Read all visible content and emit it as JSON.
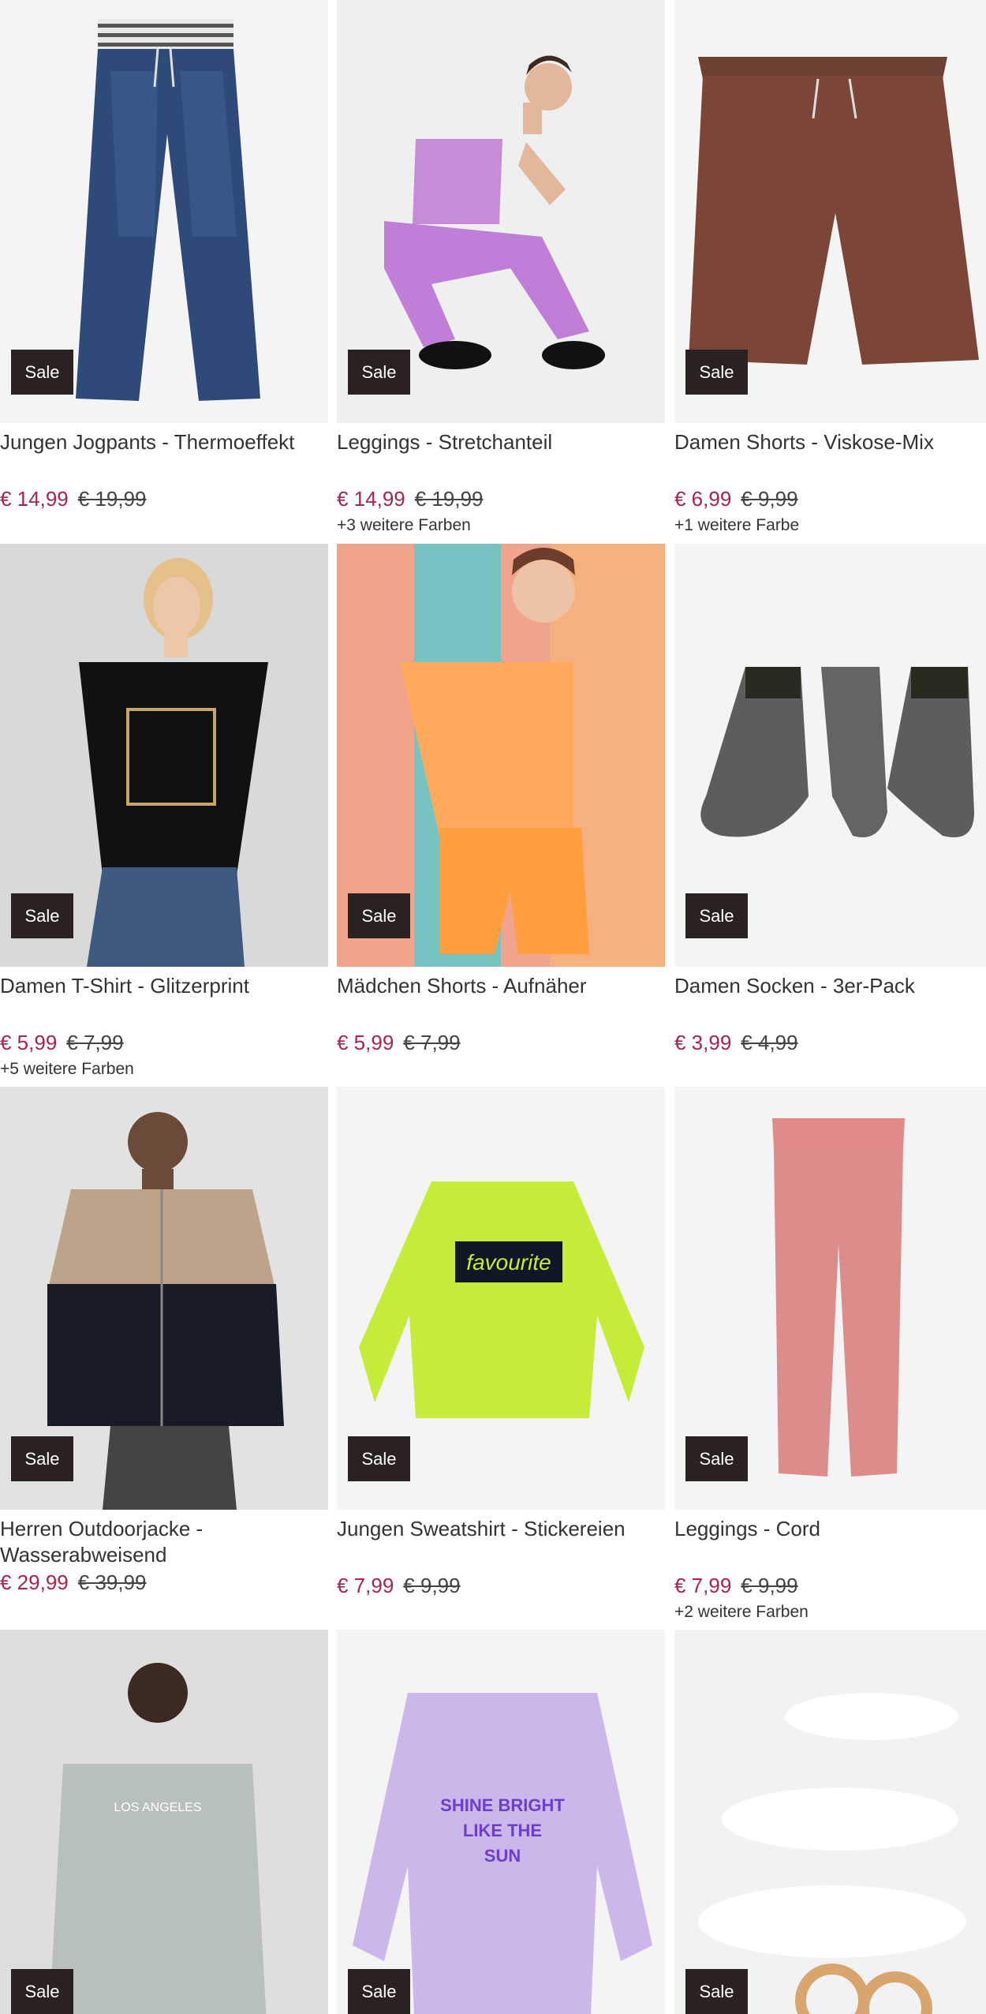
{
  "products": [
    {
      "title": "Jungen Jogpants - Thermoeffekt",
      "price": "€ 14,99",
      "old_price": "€ 19,99",
      "colors": "",
      "badge": "Sale",
      "icon": "jeans-image"
    },
    {
      "title": "Leggings - Stretchanteil",
      "price": "€ 14,99",
      "old_price": "€ 19,99",
      "colors": "+3 weitere Farben",
      "badge": "Sale",
      "icon": "leggings-model-image"
    },
    {
      "title": "Damen Shorts - Viskose-Mix",
      "price": "€ 6,99",
      "old_price": "€ 9,99",
      "colors": "+1 weitere Farbe",
      "badge": "Sale",
      "icon": "shorts-image"
    },
    {
      "title": "Damen T-Shirt - Glitzerprint",
      "price": "€ 5,99",
      "old_price": "€ 7,99",
      "colors": "+5 weitere Farben",
      "badge": "Sale",
      "icon": "tshirt-model-image"
    },
    {
      "title": "Mädchen Shorts - Aufnäher",
      "price": "€ 5,99",
      "old_price": "€ 7,99",
      "colors": "",
      "badge": "Sale",
      "icon": "girl-shorts-image"
    },
    {
      "title": "Damen Socken - 3er-Pack",
      "price": "€ 3,99",
      "old_price": "€ 4,99",
      "colors": "",
      "badge": "Sale",
      "icon": "socks-image"
    },
    {
      "title": "Herren Outdoorjacke - Wasserabweisend",
      "price": "€ 29,99",
      "old_price": "€ 39,99",
      "colors": "",
      "badge": "Sale",
      "icon": "jacket-model-image"
    },
    {
      "title": "Jungen Sweatshirt - Stickereien",
      "price": "€ 7,99",
      "old_price": "€ 9,99",
      "colors": "",
      "badge": "Sale",
      "icon": "sweatshirt-image"
    },
    {
      "title": "Leggings - Cord",
      "price": "€ 7,99",
      "old_price": "€ 9,99",
      "colors": "+2 weitere Farben",
      "badge": "Sale",
      "icon": "cord-leggings-image"
    },
    {
      "title": "",
      "price": "",
      "old_price": "",
      "colors": "",
      "badge": "Sale",
      "icon": "hoodie-model-image"
    },
    {
      "title": "",
      "price": "",
      "old_price": "",
      "colors": "",
      "badge": "Sale",
      "icon": "tiedye-sweatshirt-image"
    },
    {
      "title": "",
      "price": "",
      "old_price": "",
      "colors": "",
      "badge": "Sale",
      "icon": "earrings-image"
    }
  ],
  "prints": {
    "sweatshirt_print": "favourite",
    "tiedye_print_1": "SHINE BRIGHT",
    "tiedye_print_2": "LIKE THE",
    "tiedye_print_3": "SUN",
    "hoodie_print_1": "LOS ANGELES"
  },
  "colors": {
    "sale_price": "#a8244b",
    "badge_bg": "#2a2220"
  }
}
